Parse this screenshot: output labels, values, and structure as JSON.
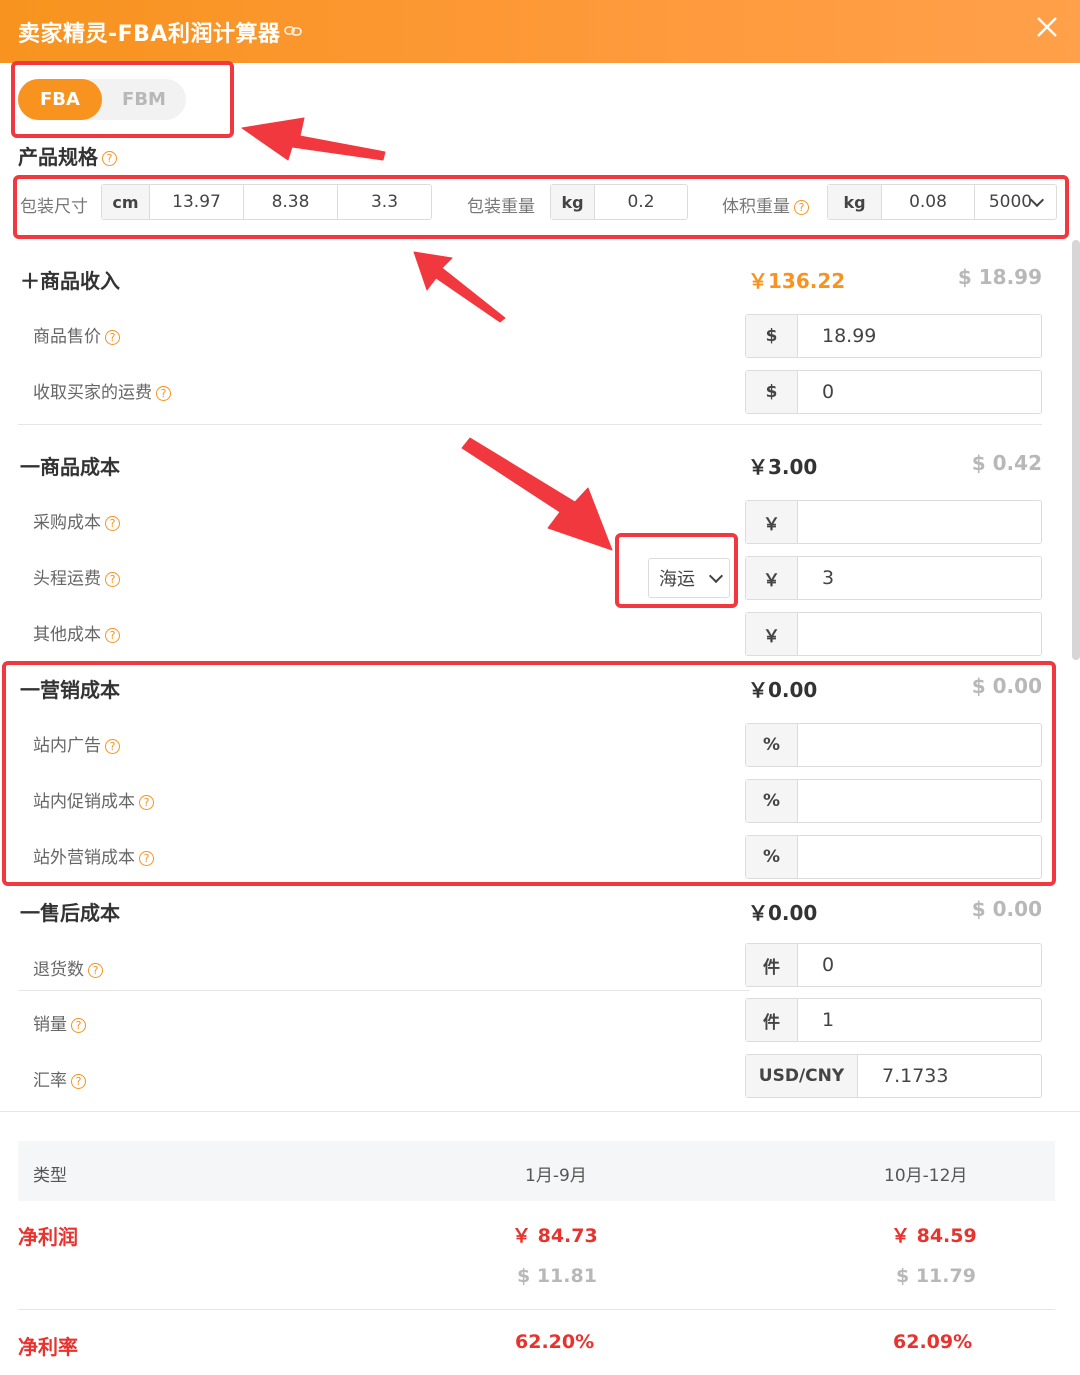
{
  "header": {
    "title": "卖家精灵-FBA利润计算器",
    "link_icon": "link-icon",
    "close_icon": "close-icon"
  },
  "toggle": {
    "fba": "FBA",
    "fbm": "FBM"
  },
  "spec": {
    "title": "产品规格",
    "pkg_size_label": "包装尺寸",
    "size_unit": "cm",
    "length": "13.97",
    "width": "8.38",
    "height": "3.3",
    "pkg_weight_label": "包装重量",
    "weight_unit": "kg",
    "weight": "0.2",
    "vol_weight_label": "体积重量",
    "vol_unit": "kg",
    "vol_weight": "0.08",
    "divisor": "5000"
  },
  "income": {
    "title": "＋商品收入",
    "rmb": "￥136.22",
    "usd": "$ 18.99",
    "price_label": "商品售价",
    "price_prefix": "$",
    "price": "18.99",
    "ship_label": "收取买家的运费",
    "ship_prefix": "$",
    "ship": "0"
  },
  "cost": {
    "title": "一商品成本",
    "rmb": "￥3.00",
    "usd": "$ 0.42",
    "purchase_label": "采购成本",
    "purchase_prefix": "￥",
    "purchase": "",
    "freight_label": "头程运费",
    "freight_mode": "海运",
    "freight_prefix": "￥",
    "freight": "3",
    "other_label": "其他成本",
    "other_prefix": "￥",
    "other": ""
  },
  "marketing": {
    "title": "一营销成本",
    "rmb": "￥0.00",
    "usd": "$ 0.00",
    "ads_label": "站内广告",
    "promo_label": "站内促销成本",
    "offsite_label": "站外营销成本",
    "prefix": "%"
  },
  "after_sales": {
    "title": "一售后成本",
    "rmb": "￥0.00",
    "usd": "$ 0.00",
    "returns_label": "退货数",
    "returns_prefix": "件",
    "returns": "0",
    "sales_label": "销量",
    "sales_prefix": "件",
    "sales": "1",
    "rate_label": "汇率",
    "rate_prefix": "USD/CNY",
    "rate": "7.1733"
  },
  "result": {
    "col_type": "类型",
    "col_1": "1月-9月",
    "col_2": "10月-12月",
    "profit_label": "净利润",
    "profit_rmb_1": "￥ 84.73",
    "profit_rmb_2": "￥ 84.59",
    "profit_usd_1": "$ 11.81",
    "profit_usd_2": "$ 11.79",
    "margin_label": "净利率",
    "margin_1": "62.20%",
    "margin_2": "62.09%"
  },
  "help_mark": "?",
  "colors": {
    "accent": "#f7931e",
    "annotation": "#f0383e",
    "profit": "#e8322e"
  }
}
